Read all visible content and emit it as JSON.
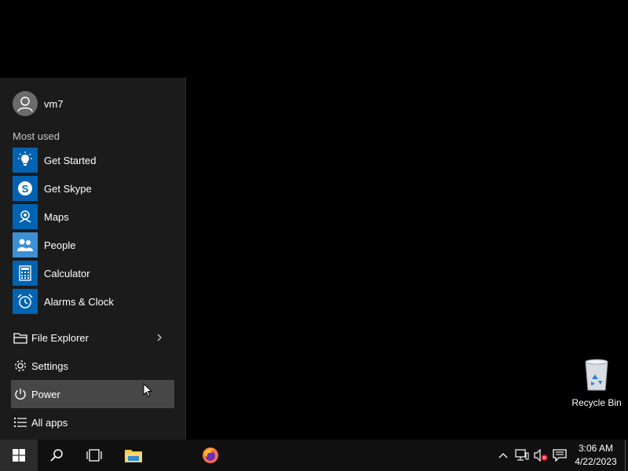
{
  "start_menu": {
    "user": {
      "name": "vm7"
    },
    "most_used_label": "Most used",
    "apps": [
      {
        "label": "Get Started",
        "icon": "lightbulb-icon"
      },
      {
        "label": "Get Skype",
        "icon": "skype-icon"
      },
      {
        "label": "Maps",
        "icon": "maps-icon"
      },
      {
        "label": "People",
        "icon": "people-icon"
      },
      {
        "label": "Calculator",
        "icon": "calculator-icon"
      },
      {
        "label": "Alarms & Clock",
        "icon": "alarm-clock-icon"
      }
    ],
    "places": [
      {
        "label": "File Explorer",
        "icon": "file-explorer-icon",
        "has_submenu": true
      },
      {
        "label": "Settings",
        "icon": "gear-icon"
      },
      {
        "label": "Power",
        "icon": "power-icon",
        "highlighted": true
      },
      {
        "label": "All apps",
        "icon": "all-apps-icon"
      }
    ]
  },
  "desktop": {
    "icons": [
      {
        "label": "Recycle Bin",
        "icon": "recycle-bin-icon"
      }
    ]
  },
  "taskbar": {
    "buttons": [
      "windows-start-icon",
      "search-icon",
      "task-view-icon",
      "file-explorer-icon",
      "firefox-icon"
    ],
    "tray": [
      "chevron-up-icon",
      "network-icon",
      "volume-muted-icon",
      "action-center-icon"
    ],
    "clock": {
      "time": "3:06 AM",
      "date": "4/22/2023"
    }
  },
  "colors": {
    "tile_blue": "#0063b1",
    "menu_bg": "#1b1b1b",
    "taskbar_bg": "#101010",
    "hover_bg": "#474747"
  }
}
